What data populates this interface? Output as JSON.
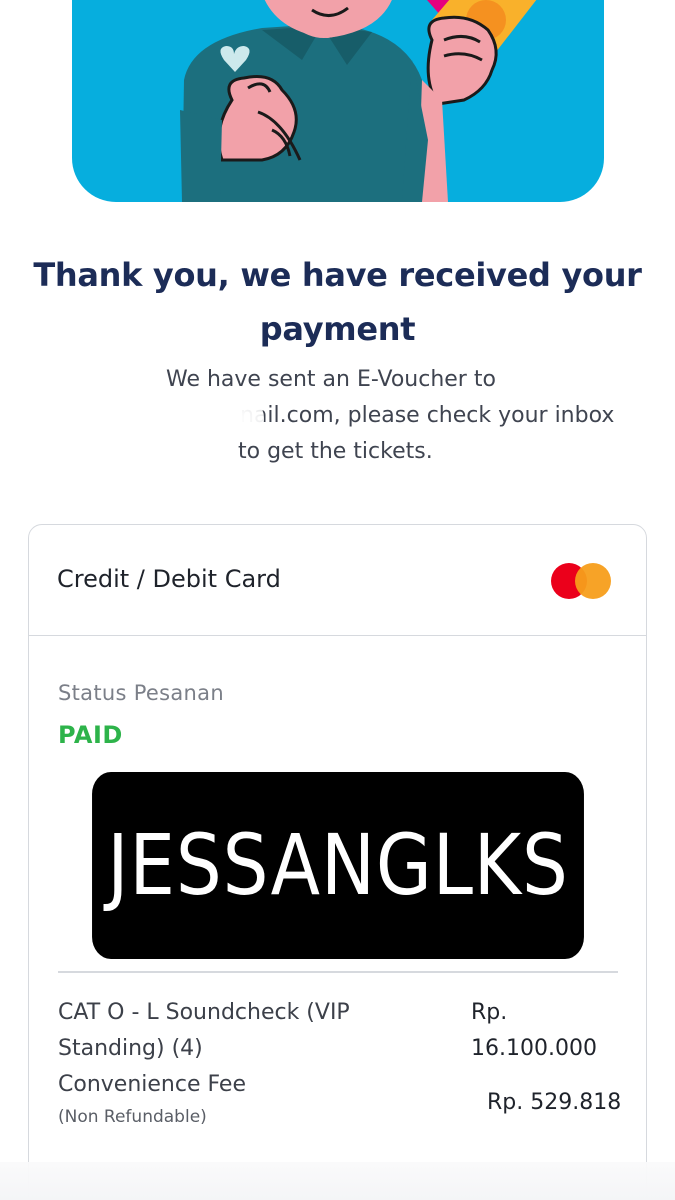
{
  "hero": {
    "illustration": "person-holding-card-illustration",
    "background_color": "#06aede"
  },
  "confirmation": {
    "title": "Thank you, we have received your payment",
    "line1": "We have sent an E-Voucher to",
    "line2": "nail.com, please check your inbox",
    "line3": "to get the tickets."
  },
  "payment": {
    "method_label": "Credit / Debit Card",
    "method_icon": "mastercard-icon",
    "status_label": "Status Pesanan",
    "status_value": "PAID",
    "status_color": "#2db34a",
    "overlay_text": "JESSANGLKS",
    "items": [
      {
        "name": "CAT O - L Soundcheck (VIP Standing) (4)",
        "price": "Rp. 16.100.000"
      }
    ],
    "fee": {
      "name": "Convenience Fee",
      "note": "(Non Refundable)",
      "price": "Rp. 529.818"
    }
  },
  "colors": {
    "title": "#1c2c57",
    "border": "#d6d9de"
  }
}
